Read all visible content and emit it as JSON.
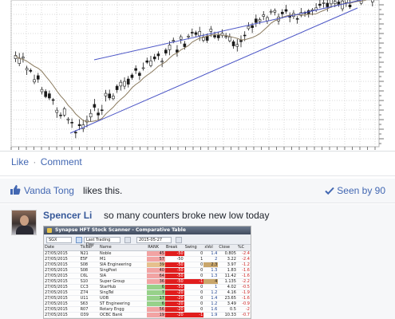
{
  "actions": {
    "like": "Like",
    "separator": "·",
    "comment": "Comment"
  },
  "likes": {
    "liker": "Vanda Tong",
    "text": "likes this.",
    "seen": "Seen by 90"
  },
  "comment": {
    "author": "Spencer Li",
    "text": "so many counters broke new low today",
    "scanner": {
      "title": "Synapse HFT Stock Scanner - Comparative Table",
      "market": "SGX",
      "mode": "Last Trading Day",
      "date": "2015-05-27",
      "columns": [
        "Date",
        "Ticker",
        "Name",
        "RANK",
        "Break",
        "Swing",
        "xVol",
        "Close",
        "%C"
      ],
      "rows": [
        [
          "27/05/2015",
          "N21",
          "Noble",
          "45",
          "-50",
          "0",
          "1.4",
          "0.805",
          "-2.4"
        ],
        [
          "27/05/2015",
          "E5F",
          "M1",
          "57",
          "-50",
          "1",
          "2",
          "3.22",
          "-2.4"
        ],
        [
          "27/05/2015",
          "S08",
          "SIA Engineering",
          "39",
          "-50",
          "0",
          "2.3",
          "3.97",
          "-1.2"
        ],
        [
          "27/05/2015",
          "S08",
          "SingPost",
          "40",
          "-50",
          "0",
          "1.3",
          "1.83",
          "-1.6"
        ],
        [
          "27/05/2015",
          "C6L",
          "SIA",
          "64",
          "-50",
          "0",
          "1.3",
          "11.42",
          "-1.6"
        ],
        [
          "27/05/2015",
          "S10",
          "Super Group",
          "36",
          "-50",
          "-1",
          "4",
          "1.135",
          "-2.2"
        ],
        [
          "27/05/2015",
          "CC3",
          "StarHub",
          "6",
          "-50",
          "0",
          "1",
          "4.02",
          "-0.5"
        ],
        [
          "27/05/2015",
          "Z74",
          "SingTel",
          "7",
          "-20",
          "0",
          "1.2",
          "4.16",
          "-1.9"
        ],
        [
          "27/05/2015",
          "U11",
          "UOB",
          "17",
          "-20",
          "0",
          "1.4",
          "23.65",
          "-1.6"
        ],
        [
          "27/05/2015",
          "S63",
          "ST Engineering",
          "6",
          "-20",
          "0",
          "1.2",
          "3.49",
          "-0.9"
        ],
        [
          "27/05/2015",
          "R07",
          "Rotary Engg",
          "56",
          "-20",
          "0",
          "1.6",
          "0.5",
          "-2"
        ],
        [
          "27/05/2015",
          "O39",
          "OCBC Bank",
          "19",
          "-20",
          "-1",
          "1.9",
          "10.33",
          "-0.7"
        ]
      ]
    }
  },
  "colors": {
    "link": "#4267b2",
    "candle": "#1a1a1a",
    "moving_average": "#8a7a5e",
    "channel": "#4b55c6",
    "grid": "#d8d8d8"
  },
  "icons": {
    "like": "thumbs-up-icon",
    "seen": "checkmark-icon"
  }
}
